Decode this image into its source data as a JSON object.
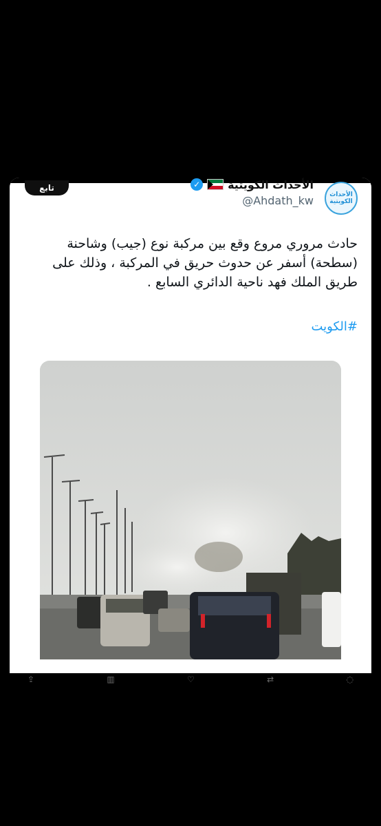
{
  "tweet": {
    "display_name": "الأحداث الكويتية",
    "handle": "@Ahdath_kw",
    "follow_label": "تابع",
    "avatar_text_line1": "الأحداث",
    "avatar_text_line2": "الكويتية",
    "text": "حادث مروري مروع وقع بين مركبة نوع (جيب) وشاحنة (سطحة) أسفر عن حدوث حريق في المركبة ، وذلك على طريق الملك فهد ناحية الدائري السابع .",
    "hashtag": "#الكويت"
  },
  "colors": {
    "link": "#1d9bf0",
    "background": "#000000",
    "card": "#ffffff"
  },
  "icons": {
    "verified": "verified-badge-icon",
    "flag": "kuwait-flag-icon"
  }
}
